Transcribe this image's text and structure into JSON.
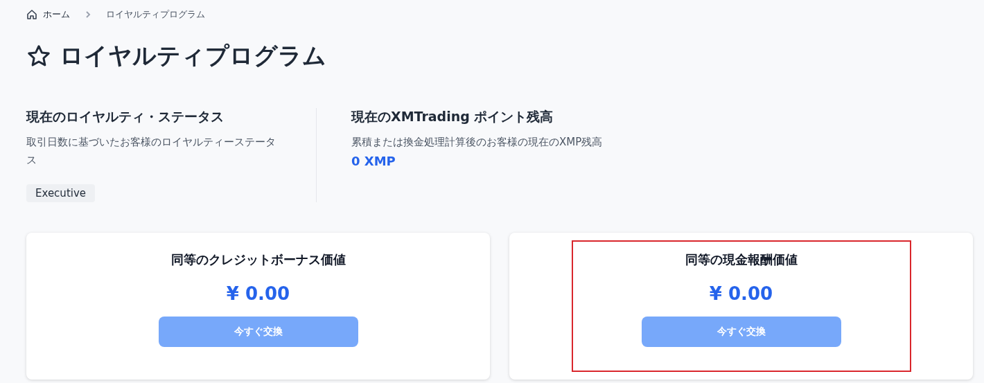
{
  "breadcrumb": [
    {
      "label": "ホーム",
      "kind": "home"
    },
    {
      "label": "ロイヤルティプログラム",
      "kind": "current"
    }
  ],
  "title": "ロイヤルティプログラム",
  "status": {
    "heading": "現在のロイヤルティ・ステータス",
    "description": "取引日数に基づいたお客様のロイヤルティーステータス",
    "badge": "Executive"
  },
  "points": {
    "heading": "現在のXMTrading ポイント残高",
    "description": "累積または換金処理計算後のお客様の現在のXMP残高",
    "value": "0 XMP"
  },
  "cards": [
    {
      "title": "同等のクレジットボーナス価値",
      "amount": "¥ 0.00",
      "button": {
        "label": "今すぐ交換",
        "disabled": true
      },
      "highlighted": false
    },
    {
      "title": "同等の現金報酬価値",
      "amount": "¥ 0.00",
      "button": {
        "label": "今すぐ交換",
        "disabled": true
      },
      "highlighted": true
    }
  ]
}
